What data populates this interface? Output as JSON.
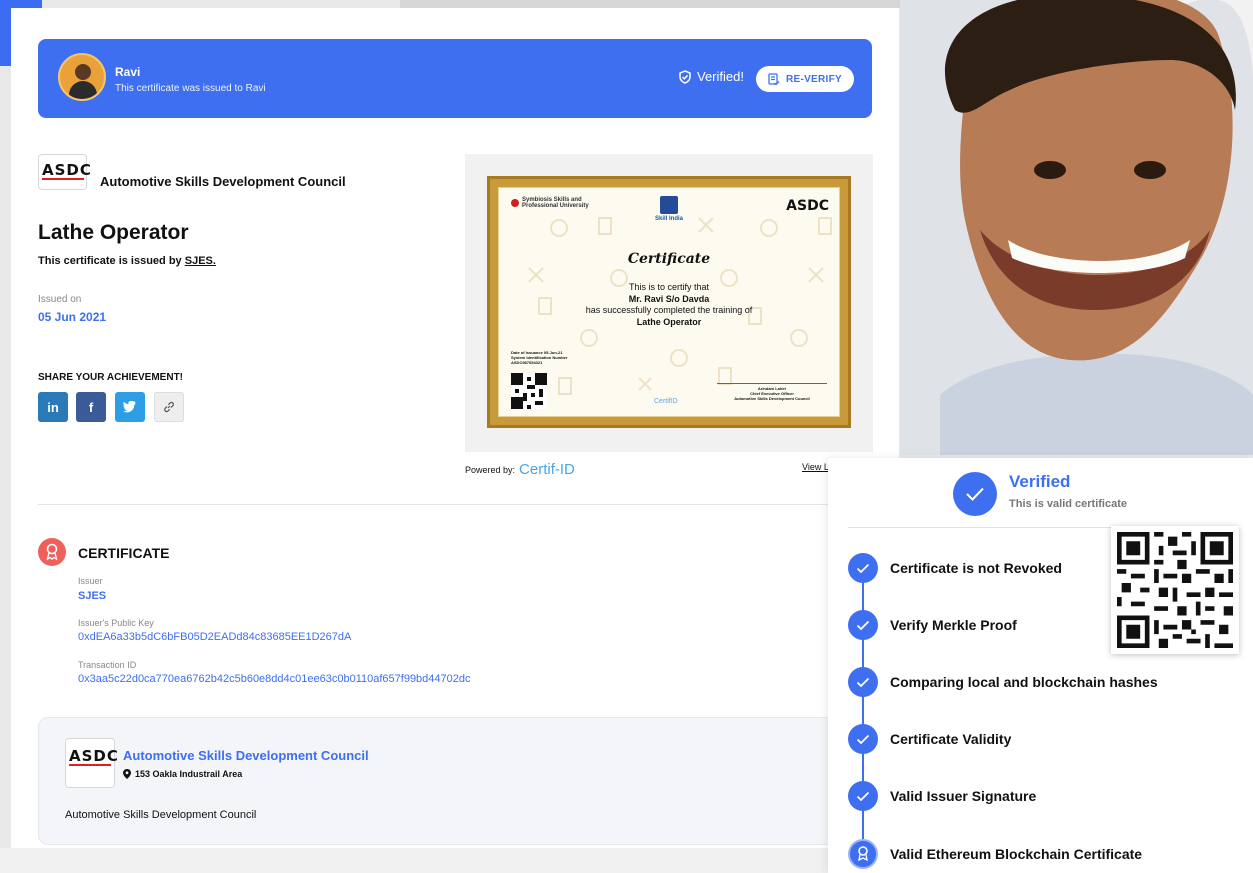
{
  "banner": {
    "recipient": "Ravi",
    "issued_to": "This certificate was issued to Ravi",
    "verified": "Verified!",
    "reverify": "RE-VERIFY"
  },
  "issuer_org": {
    "logo_text": "ASDC",
    "name": "Automotive Skills Development Council"
  },
  "course": {
    "title": "Lathe Operator",
    "issued_by_prefix": "This certificate is issued by",
    "issued_by": "SJES.",
    "issued_on_label": "Issued on",
    "issued_on": "05 Jun 2021"
  },
  "share": {
    "label": "SHARE YOUR ACHIEVEMENT!",
    "buttons": [
      {
        "glyph": "in",
        "icon": "linkedin-icon",
        "color": "#2a7ab8"
      },
      {
        "glyph": "f",
        "icon": "facebook-icon",
        "color": "#3b5a98"
      },
      {
        "glyph": "✓",
        "icon": "twitter-icon",
        "color": "#2d9ee6"
      },
      {
        "glyph": "∞",
        "icon": "link-icon",
        "color": "#eeeeee"
      }
    ]
  },
  "certificate_preview": {
    "university": "Symbiosis Skills and Professional University",
    "skill_india": "Skill India",
    "asdc": "ASDC",
    "title": "Certificate",
    "line1": "This is to certify that",
    "name": "Mr. Ravi S/o Davda",
    "line3": "has successfully completed the training of",
    "course": "Lathe Operator",
    "meta1": "Date of Issuance 05-Jun-21",
    "meta2": "System Identification Number",
    "meta3": "ASDC987654321",
    "signer": "Arindam Lahiri",
    "signer_title": "Chief Executive Officer",
    "signer_org": "Automotive Skills Development Council",
    "certif": "CertifID"
  },
  "powered_by": {
    "label": "Powered by:",
    "brand": "Certif-ID",
    "view_link": "View L"
  },
  "certificate_section": {
    "heading": "CERTIFICATE",
    "issuer_label": "Issuer",
    "issuer": "SJES",
    "public_key_label": "Issuer's Public Key",
    "public_key": "0xdEA6a33b5dC6bFB05D2EADd84c83685EE1D267dA",
    "transaction_label": "Transaction ID",
    "transaction": "0x3aa5c22d0ca770ea6762b42c5b60e8dd4c01ee63c0b0110af657f99bd44702dc"
  },
  "org_card": {
    "name": "Automotive Skills Development Council",
    "address": "153 Oakla Industrail Area",
    "description": "Automotive Skills Development Council"
  },
  "verify_panel": {
    "title": "Verified",
    "subtitle": "This is valid certificate",
    "steps": [
      "Certificate is not Revoked",
      "Verify Merkle Proof",
      "Comparing local and blockchain hashes",
      "Certificate Validity",
      "Valid Issuer Signature",
      "Valid Ethereum Blockchain Certificate"
    ]
  },
  "colors": {
    "accent": "#3d6ff0",
    "brand_red": "#e02020",
    "badge": "#f0605b",
    "gold": "#c89a3a"
  }
}
